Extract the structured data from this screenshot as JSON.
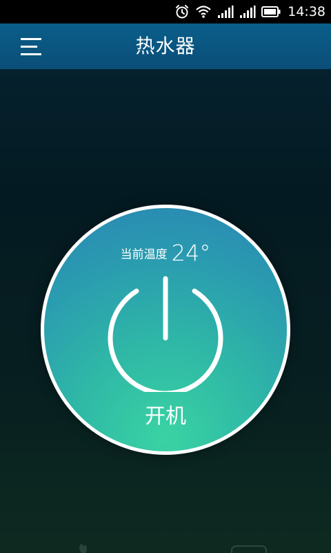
{
  "status_bar": {
    "time": "14:38",
    "icons": [
      "alarm-icon",
      "wifi-icon",
      "signal-icon",
      "signal-icon",
      "battery-icon"
    ]
  },
  "app_bar": {
    "title": "热水器",
    "menu_icon": "menu-icon"
  },
  "power_panel": {
    "temp_label": "当前温度",
    "temp_value": "24°",
    "power_icon": "power-icon",
    "power_label": "开机"
  },
  "colors": {
    "app_bar": "#0a4e78",
    "circle_top": "#2a84b4",
    "circle_bottom": "#3ad3a3",
    "background": "#041a22"
  }
}
